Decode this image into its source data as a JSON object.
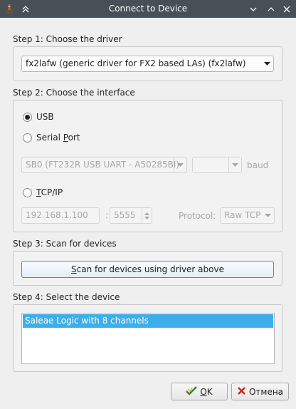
{
  "window": {
    "title": "Connect to Device"
  },
  "step1": {
    "label": "Step 1: Choose the driver",
    "driver_selected": "fx2lafw (generic driver for FX2 based LAs) (fx2lafw)"
  },
  "step2": {
    "label": "Step 2: Choose the interface",
    "usb_label": "USB",
    "serial_label_pre": "Serial ",
    "serial_label_mnemonic": "P",
    "serial_label_post": "ort",
    "serial_port_selected": "SB0 (FT232R USB UART - A50285BI)",
    "baud_value": "",
    "baud_label": "baud",
    "tcpip_label_mnemonic": "T",
    "tcpip_label_post": "CP/IP",
    "host_value": "192.168.1.100",
    "port_separator": ":",
    "port_value": "5555",
    "protocol_label": "Protocol:",
    "protocol_selected": "Raw TCP"
  },
  "step3": {
    "label": "Step 3: Scan for devices",
    "scan_button_mnemonic": "S",
    "scan_button_rest": "can for devices using driver above"
  },
  "step4": {
    "label": "Step 4: Select the device",
    "devices": [
      "Saleae Logic with 8 channels"
    ]
  },
  "buttons": {
    "ok_mnemonic": "O",
    "ok_rest": "K",
    "cancel": "Отмена"
  },
  "colors": {
    "titlebar": "#475057",
    "selection": "#3daee9",
    "focus_border": "#3b8ed6"
  },
  "icons": {
    "ok": "checkmark-icon",
    "cancel": "red-x-icon"
  }
}
